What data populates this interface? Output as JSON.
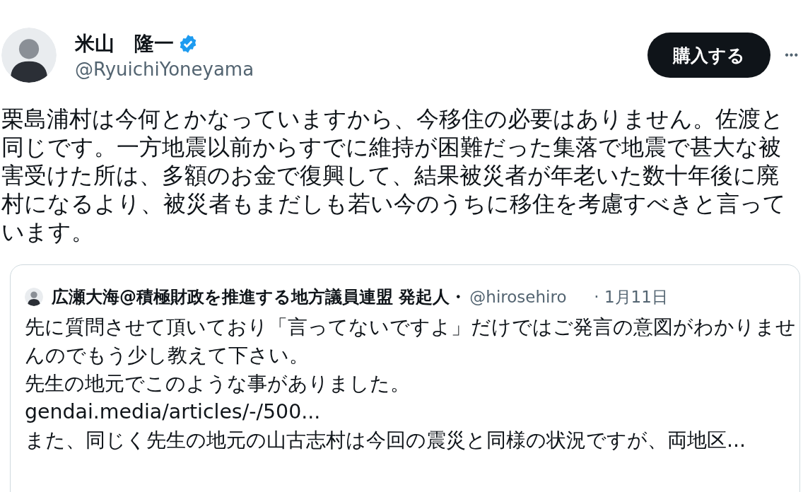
{
  "author": {
    "name": "米山　隆一",
    "verified": true,
    "handle": "@RyuichiYoneyama"
  },
  "buy_button": "購入する",
  "more_button": "•••",
  "text": "栗島浦村は今何とかなっていますから、今移住の必要はありません。佐渡と同じです。一方地震以前からすでに維持が困難だった集落で地震で甚大な被害受けた所は、多額のお金で復興して、結果被災者が年老いた数十年後に廃村になるより、被災者もまだしも若い今のうちに移住を考慮すべきと言っています。",
  "quote": {
    "author": {
      "name": "広瀬大海@積極財政を推進する地方議員連盟 発起人・",
      "handle": "@hirosehiro",
      "date": "· 1月11日"
    },
    "paragraphs": [
      {
        "kind": "text",
        "text": "先に質問させて頂いており「言ってないですよ」だけではご発言の意図がわかりませんのでもう少し教えて下さい。"
      },
      {
        "kind": "text",
        "text": "先生の地元でこのような事がありました。"
      },
      {
        "kind": "link",
        "text": "gendai.media/articles/-/500..."
      },
      {
        "kind": "text",
        "text": "また、同じく先生の地元の山古志村は今回の震災と同様の状況ですが、両地区..."
      }
    ]
  }
}
